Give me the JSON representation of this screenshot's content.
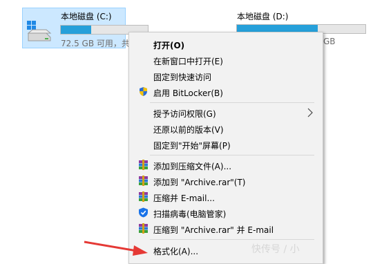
{
  "drives": {
    "c": {
      "name": "本地磁盘 (C:)",
      "space_text": "72.5 GB 可用，共",
      "used_fraction": 0.35
    },
    "d": {
      "name": "本地磁盘 (D:)",
      "space_text": "GB",
      "used_fraction": 0.63
    }
  },
  "colors": {
    "selection": "#cce8ff",
    "bar_fill": "#26a0da",
    "menu_bg": "#f2f2f2",
    "arrow": "#e53935"
  },
  "context_menu": {
    "items": [
      {
        "label": "打开(O)"
      },
      {
        "label": "在新窗口中打开(E)"
      },
      {
        "label": "固定到快速访问"
      },
      {
        "label": "启用 BitLocker(B)",
        "icon": "shield-icon"
      },
      {
        "label": "授予访问权限(G)"
      },
      {
        "label": "还原以前的版本(V)"
      },
      {
        "label": "固定到\"开始\"屏幕(P)"
      },
      {
        "label": "添加到压缩文件(A)...",
        "icon": "winrar-icon"
      },
      {
        "label": "添加到 \"Archive.rar\"(T)",
        "icon": "winrar-icon"
      },
      {
        "label": "压缩并 E-mail...",
        "icon": "winrar-icon"
      },
      {
        "label": "扫描病毒(电脑管家)",
        "icon": "tencent-pc-manager-icon"
      },
      {
        "label": "压缩到 \"Archive.rar\" 并 E-mail",
        "icon": "winrar-icon"
      },
      {
        "label": "格式化(A)..."
      }
    ]
  },
  "watermark": "快传号 / 小"
}
